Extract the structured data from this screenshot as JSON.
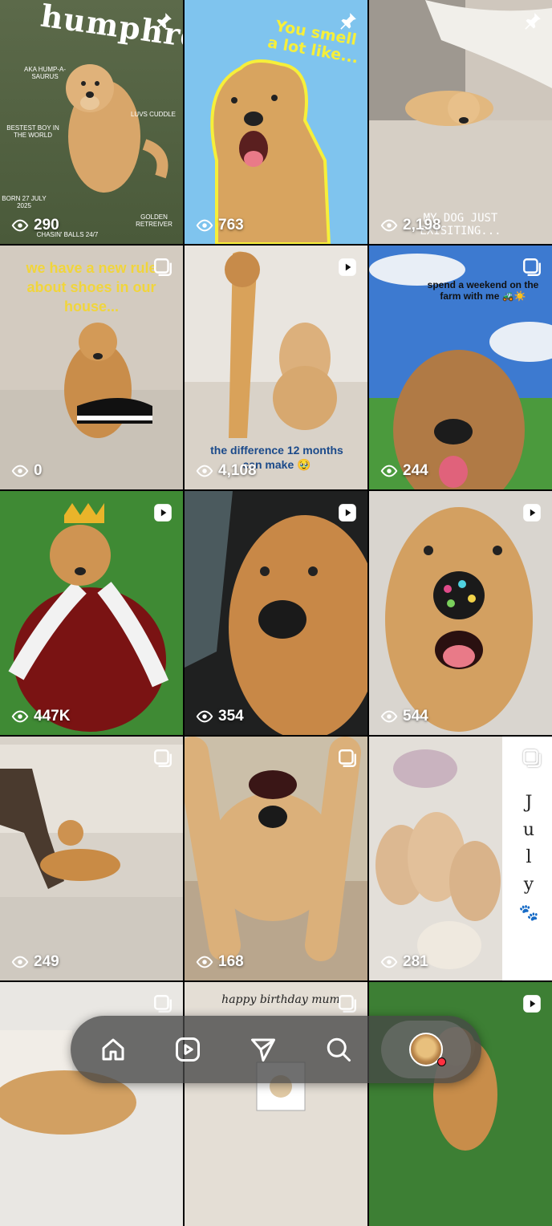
{
  "tiles": [
    {
      "views": "290",
      "badge": "pin",
      "title": "humphrey",
      "captions": [
        "AKA HUMP-A-SAURUS",
        "BESTEST BOY IN THE WORLD",
        "BORN 27 JULY 2025",
        "LUVS CUDDLE",
        "GOLDEN RETREIVER",
        "CHASIN' BALLS 24/7"
      ]
    },
    {
      "views": "763",
      "badge": "pin",
      "caption": "You smell a lot like..."
    },
    {
      "views": "2,198",
      "badge": "pin",
      "caption": "MY DOG JUST EXISITING..."
    },
    {
      "views": "0",
      "badge": "carousel",
      "caption": "we have a new rule about shoes in our house..."
    },
    {
      "views": "4,108",
      "badge": "reel",
      "caption": "the difference 12 months can make 🥹"
    },
    {
      "views": "244",
      "badge": "carousel",
      "caption": "spend a weekend on the farm with me 🚜☀️"
    },
    {
      "views": "447K",
      "badge": "reel"
    },
    {
      "views": "354",
      "badge": "reel"
    },
    {
      "views": "544",
      "badge": "reel"
    },
    {
      "views": "249",
      "badge": "carousel"
    },
    {
      "views": "168",
      "badge": "carousel"
    },
    {
      "views": "281",
      "badge": "carousel",
      "caption_letters": [
        "J",
        "u",
        "l",
        "y"
      ]
    },
    {
      "badge": "carousel"
    },
    {
      "badge": "carousel",
      "caption": "happy birthday mum"
    },
    {
      "badge": "reel"
    }
  ],
  "nav": {
    "items": [
      "home-icon",
      "reels-icon",
      "send-icon",
      "search-icon",
      "profile-avatar"
    ],
    "active": "profile-avatar",
    "notification_color": "#ff3040"
  }
}
